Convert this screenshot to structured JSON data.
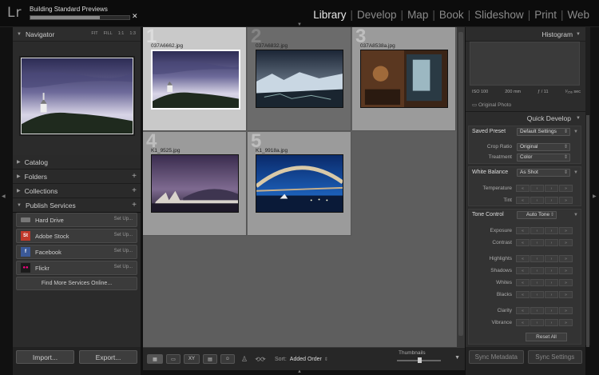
{
  "app": {
    "logo": "Lr",
    "progress_label": "Building Standard Previews",
    "progress_fraction": 0.7,
    "close_glyph": "✕"
  },
  "modules": [
    "Library",
    "Develop",
    "Map",
    "Book",
    "Slideshow",
    "Print",
    "Web"
  ],
  "active_module": "Library",
  "navigator": {
    "title": "Navigator",
    "zoom": [
      "FIT",
      "FILL",
      "1:1",
      "1:3"
    ]
  },
  "left_panels": [
    {
      "label": "Catalog",
      "plus": ""
    },
    {
      "label": "Folders",
      "plus": "+"
    },
    {
      "label": "Collections",
      "plus": "+"
    },
    {
      "label": "Publish Services",
      "plus": "+"
    }
  ],
  "services": [
    {
      "label": "Hard Drive",
      "setup": "Set Up...",
      "icon": "hard-drive-icon",
      "glyph": "",
      "color": "#777777"
    },
    {
      "label": "Adobe Stock",
      "setup": "Set Up...",
      "icon": "adobe-stock-icon",
      "glyph": "St",
      "color": "#c0392b"
    },
    {
      "label": "Facebook",
      "setup": "Set Up...",
      "icon": "facebook-icon",
      "glyph": "f",
      "color": "#3b5998"
    },
    {
      "label": "Flickr",
      "setup": "Set Up...",
      "icon": "flickr-icon",
      "glyph": "●●",
      "color": "#1b1b1b"
    }
  ],
  "find_more": "Find More Services Online...",
  "import_label": "Import...",
  "export_label": "Export...",
  "grid": [
    {
      "num": "1",
      "name": "037A6662.jpg"
    },
    {
      "num": "2",
      "name": "037A6832.jpg"
    },
    {
      "num": "3",
      "name": "037A8538a.jpg"
    },
    {
      "num": "4",
      "name": "K1_9525.jpg"
    },
    {
      "num": "5",
      "name": "K1_9918a.jpg"
    }
  ],
  "toolbar": {
    "sort_label": "Sort:",
    "sort_value": "Added Order",
    "thumbnails_label": "Thumbnails",
    "compare_label": "XY"
  },
  "histogram": {
    "title": "Histogram",
    "iso": "ISO 100",
    "focal": "200 mm",
    "aperture": "ƒ / 11",
    "shutter": "¹⁄₂₅₆ sec",
    "original": "Original Photo"
  },
  "quick_develop": {
    "title": "Quick Develop",
    "saved_preset_label": "Saved Preset",
    "saved_preset_value": "Default Settings",
    "crop_label": "Crop Ratio",
    "crop_value": "Original",
    "treatment_label": "Treatment",
    "treatment_value": "Color",
    "wb_label": "White Balance",
    "wb_value": "As Shot",
    "temperature_label": "Temperature",
    "tint_label": "Tint",
    "tone_label": "Tone Control",
    "auto_tone": "Auto Tone",
    "exposure_label": "Exposure",
    "contrast_label": "Contrast",
    "highlights_label": "Highlights",
    "shadows_label": "Shadows",
    "whites_label": "Whites",
    "blacks_label": "Blacks",
    "clarity_label": "Clarity",
    "vibrance_label": "Vibrance",
    "reset_all": "Reset All"
  },
  "sync_metadata": "Sync Metadata",
  "sync_settings": "Sync Settings"
}
